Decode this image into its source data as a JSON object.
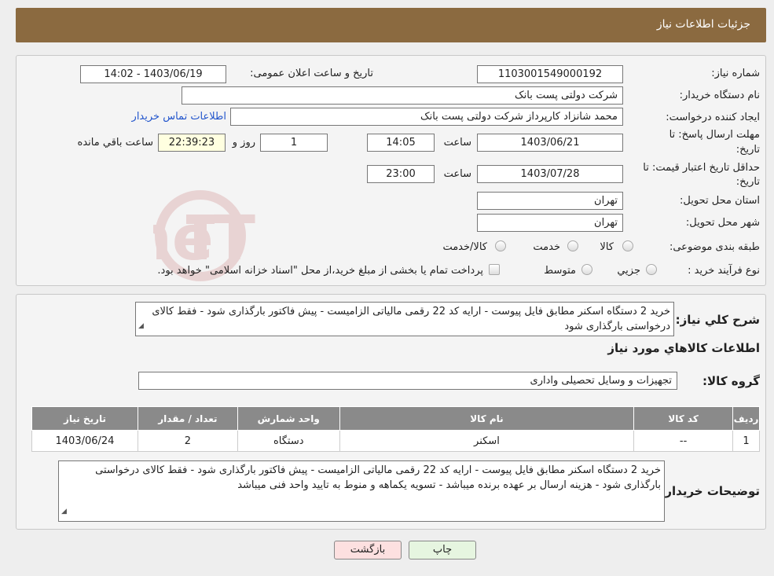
{
  "header": {
    "title": "جزئیات اطلاعات نیاز"
  },
  "form": {
    "need_number_label": "شماره نیاز:",
    "need_number": "1103001549000192",
    "announce_label": "تاریخ و ساعت اعلان عمومی:",
    "announce_value": "1403/06/19 - 14:02",
    "buyer_org_label": "نام دستگاه خریدار:",
    "buyer_org": "شرکت دولتی پست بانک",
    "creator_label": "ایجاد کننده درخواست:",
    "creator": "محمد شانزاد کارپرداز شرکت دولتی پست بانک",
    "contact_link": "اطلاعات تماس خریدار",
    "deadline_label_1": "مهلت ارسال پاسخ: تا",
    "deadline_label_2": "تاریخ:",
    "deadline_date": "1403/06/21",
    "time_label": "ساعت",
    "deadline_time": "14:05",
    "days_value": "1",
    "days_label": "روز و",
    "remaining_time": "22:39:23",
    "remaining_label": "ساعت باقي مانده",
    "validity_label_1": "حداقل تاریخ اعتبار قیمت: تا",
    "validity_label_2": "تاریخ:",
    "validity_date": "1403/07/28",
    "validity_time": "23:00",
    "province_label": "استان محل تحویل:",
    "province": "تهران",
    "city_label": "شهر محل تحویل:",
    "city": "تهران",
    "category_label": "طبقه بندی موضوعی:",
    "category_options": [
      "کالا",
      "خدمت",
      "کالا/خدمت"
    ],
    "process_label": "نوع فرآیند خرید :",
    "process_options": [
      "جزیي",
      "متوسط"
    ],
    "process_note": "پرداخت تمام یا بخشی از مبلغ خرید،از محل \"اسناد خزانه اسلامی\" خواهد بود."
  },
  "details": {
    "summary_label": "شرح كلي نياز:",
    "summary": "خرید 2 دستگاه اسکنر مطابق فایل پیوست - ارایه کد 22 رقمی مالیاتی الزامیست - پیش فاکتور بارگذاری شود - فقط کالای درخواستی بارگذاری شود",
    "goods_info_title": "اطلاعات كالاهاي مورد نياز",
    "group_label": "گروه كالا:",
    "group_value": "تجهیزات و وسایل تحصیلی واداری",
    "table": {
      "headers": [
        "رديف",
        "کد کالا",
        "نام کالا",
        "واحد شمارش",
        "تعداد / مقدار",
        "تاریخ نیاز"
      ],
      "rows": [
        [
          "1",
          "--",
          "اسکنر",
          "دستگاه",
          "2",
          "1403/06/24"
        ]
      ]
    },
    "buyer_notes_label": "توضیحات خریدار:",
    "buyer_notes": "خرید 2 دستگاه اسکنر مطابق فایل پیوست - ارایه کد 22 رقمی مالیاتی الزامیست - پیش فاکتور بارگذاری شود - فقط کالای درخواستی بارگذاری شود - هزینه ارسال بر عهده برنده میباشد - تسویه یکماهه و منوط به تایید  واحد فنی میباشد"
  },
  "buttons": {
    "print": "چاپ",
    "back": "بازگشت"
  },
  "watermark": "AriaTender.neT",
  "colors": {
    "header": "#8b6a40",
    "table_header": "#8a8a8a",
    "back_button": "#fde0e0",
    "print_button": "#e6f5e0"
  }
}
